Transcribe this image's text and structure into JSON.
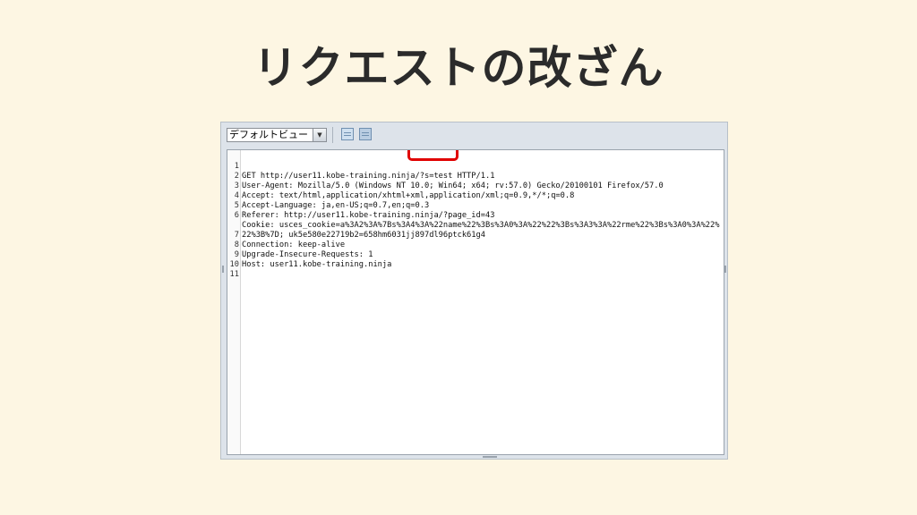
{
  "slide": {
    "title": "リクエストの改ざん"
  },
  "toolbar": {
    "view_select": "デフォルトビュー",
    "view_select_arrow": "▼",
    "layout_button_1_icon": "single-pane-icon",
    "layout_button_2_icon": "split-pane-icon"
  },
  "editor": {
    "lines": [
      {
        "num": "1",
        "text": "GET http://user11.kobe-training.ninja/?s=test HTTP/1.1"
      },
      {
        "num": "2",
        "text": "User-Agent: Mozilla/5.0 (Windows NT 10.0; Win64; x64; rv:57.0) Gecko/20100101 Firefox/57.0"
      },
      {
        "num": "3",
        "text": "Accept: text/html,application/xhtml+xml,application/xml;q=0.9,*/*;q=0.8"
      },
      {
        "num": "4",
        "text": "Accept-Language: ja,en-US;q=0.7,en;q=0.3"
      },
      {
        "num": "5",
        "text": "Referer: http://user11.kobe-training.ninja/?page_id=43"
      },
      {
        "num": "6",
        "text": "Cookie: usces_cookie=a%3A2%3A%7Bs%3A4%3A%22name%22%3Bs%3A0%3A%22%22%3Bs%3A3%3A%22rme%22%3Bs%3A0%3A%22%"
      },
      {
        "num": "",
        "text": "22%3B%7D; uk5e580e22719b2=658hm6031jj897dl96ptck61g4"
      },
      {
        "num": "7",
        "text": "Connection: keep-alive"
      },
      {
        "num": "8",
        "text": "Upgrade-Insecure-Requests: 1"
      },
      {
        "num": "9",
        "text": "Host: user11.kobe-training.ninja"
      },
      {
        "num": "10",
        "text": ""
      },
      {
        "num": "11",
        "text": ""
      }
    ]
  },
  "colors": {
    "background": "#fdf6e3",
    "highlight_box": "#e00000"
  }
}
